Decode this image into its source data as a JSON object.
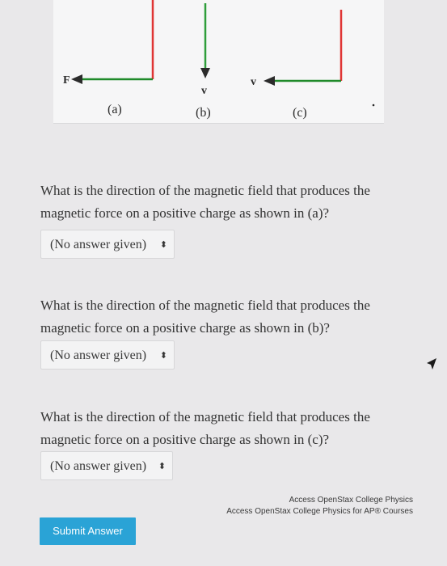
{
  "figure": {
    "label_force": "F",
    "label_velocity_b": "v",
    "label_velocity_c": "v",
    "captions": [
      "(a)",
      "(b)",
      "(c)"
    ],
    "colors": {
      "force": "#e03535",
      "velocity": "#1f8a2a",
      "arrow": "#2b2b2b"
    }
  },
  "questions": [
    {
      "text": "What is the direction of the magnetic field that produces the magnetic force on a positive charge as shown in (a)?",
      "selected": "(No answer given)"
    },
    {
      "text": "What is the direction of the magnetic field that produces the magnetic force on a positive charge as shown in (b)?",
      "selected": "(No answer given)"
    },
    {
      "text": "What is the direction of the magnetic field that produces the magnetic force on a positive charge as shown in (c)?",
      "selected": "(No answer given)"
    }
  ],
  "dropdown_caret": "⬍",
  "attribution": {
    "line1": "Access OpenStax College Physics",
    "line2": "Access OpenStax College Physics for AP® Courses"
  },
  "submit_label": "Submit Answer"
}
